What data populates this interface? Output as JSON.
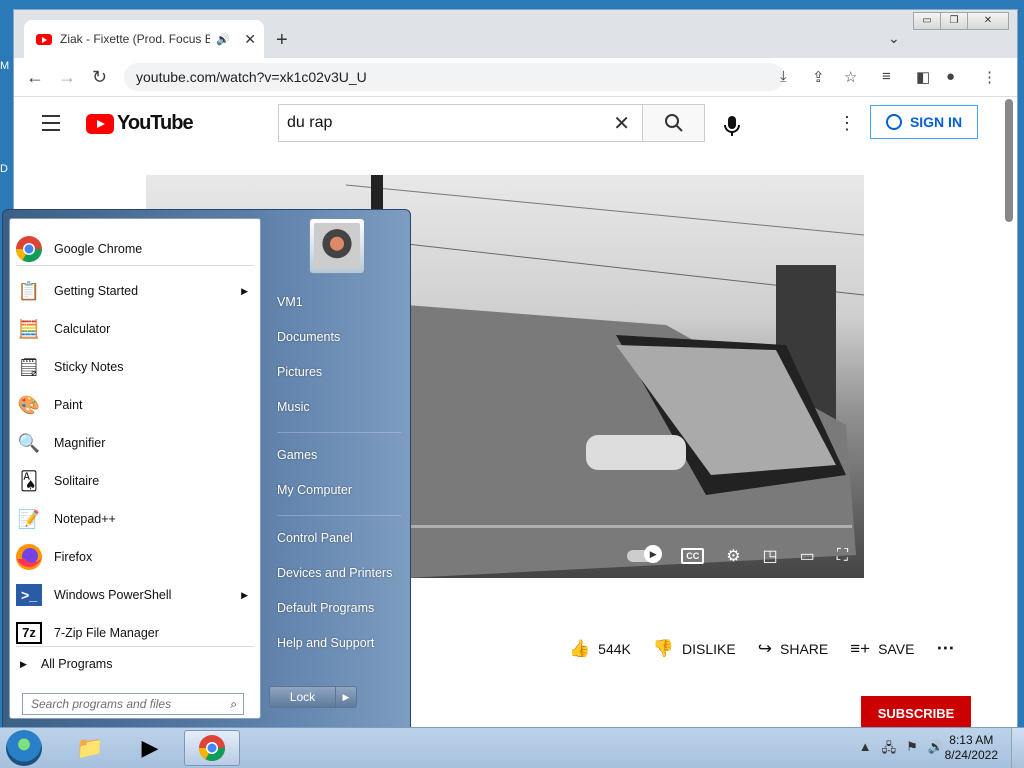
{
  "desktop": {
    "labels": [
      "M",
      "D"
    ]
  },
  "browser": {
    "tab_title": "Ziak - Fixette (Prod. Focus Be",
    "url": "youtube.com/watch?v=xk1c02v3U_U"
  },
  "youtube": {
    "logo_text": "YouTube",
    "search_query": "du rap",
    "sign_in": "SIGN IN",
    "likes": "544K",
    "dislike": "DISLIKE",
    "share": "SHARE",
    "save": "SAVE",
    "subscribe": "SUBSCRIBE",
    "cc": "CC"
  },
  "start_menu": {
    "programs": [
      {
        "label": "Google Chrome",
        "icon": "chrome-icon"
      },
      {
        "label": "Getting Started",
        "icon": "getting-started-icon",
        "submenu": true
      },
      {
        "label": "Calculator",
        "icon": "calculator-icon"
      },
      {
        "label": "Sticky Notes",
        "icon": "sticky-notes-icon"
      },
      {
        "label": "Paint",
        "icon": "paint-icon"
      },
      {
        "label": "Magnifier",
        "icon": "magnifier-icon"
      },
      {
        "label": "Solitaire",
        "icon": "solitaire-icon"
      },
      {
        "label": "Notepad++",
        "icon": "notepad-plus-plus-icon"
      },
      {
        "label": "Firefox",
        "icon": "firefox-icon"
      },
      {
        "label": "Windows PowerShell",
        "icon": "powershell-icon",
        "submenu": true
      },
      {
        "label": "7-Zip File Manager",
        "icon": "7zip-icon"
      }
    ],
    "all_programs": "All Programs",
    "search_placeholder": "Search programs and files",
    "places": [
      "VM1",
      "Documents",
      "Pictures",
      "Music",
      "Games",
      "My Computer",
      "Control Panel",
      "Devices and Printers",
      "Default Programs",
      "Help and Support"
    ],
    "lock": "Lock"
  },
  "taskbar": {
    "time": "8:13 AM",
    "date": "8/24/2022"
  }
}
